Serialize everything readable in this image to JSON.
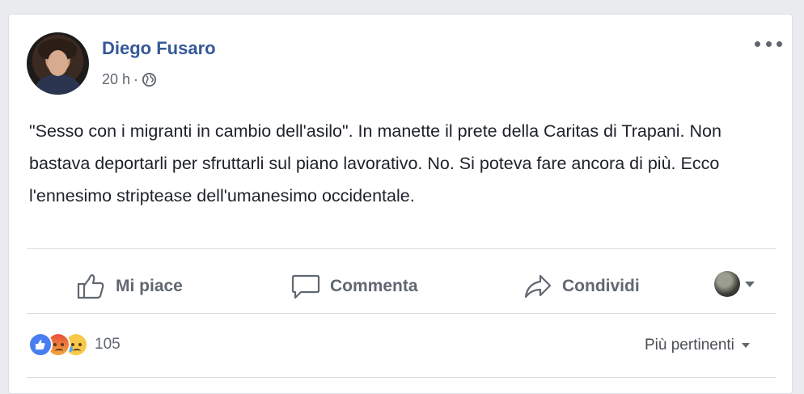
{
  "post": {
    "author": "Diego Fusaro",
    "time": "20 h",
    "separator": "·",
    "privacy_icon": "globe-icon",
    "text": "\"Sesso con i migranti in cambio dell'asilo\". In manette il prete della Caritas di Trapani. Non bastava deportarli per sfruttarli sul piano lavorativo. No. Si poteva fare ancora di più. Ecco l'ennesimo striptease dell'umanesimo occidentale."
  },
  "actions": {
    "like_label": "Mi piace",
    "comment_label": "Commenta",
    "share_label": "Condividi"
  },
  "reactions": {
    "types": [
      "like",
      "angry",
      "sad"
    ],
    "count": "105"
  },
  "comments": {
    "sort_label": "Più pertinenti"
  },
  "colors": {
    "author_link": "#365899",
    "like_blue": "#4a7ef0",
    "page_bg": "#e9ebee"
  }
}
